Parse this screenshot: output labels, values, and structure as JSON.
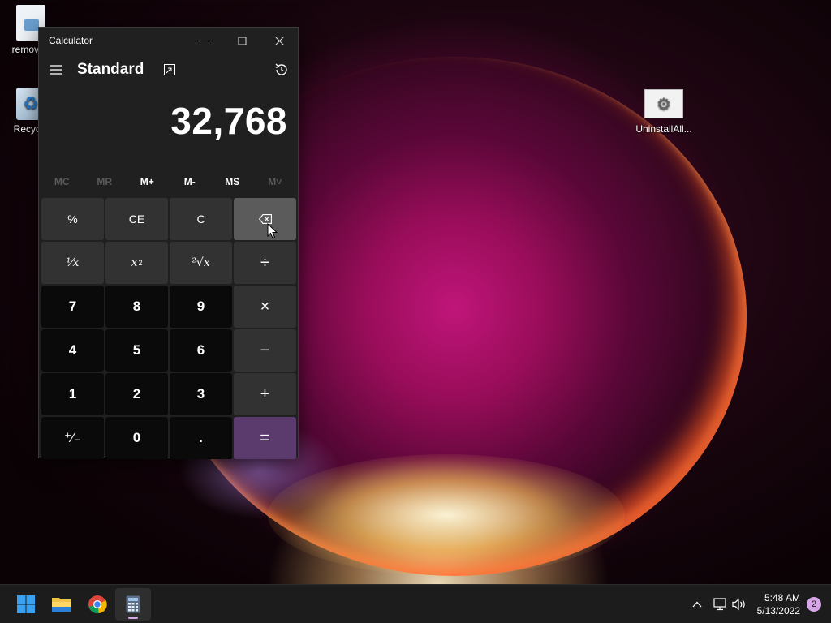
{
  "desktop": {
    "icons": [
      {
        "label": "remove_",
        "icon": "file-icon"
      },
      {
        "label": "Recycle",
        "icon": "recycle-bin-icon"
      },
      {
        "label": "UninstallAll...",
        "icon": "setup-icon"
      }
    ]
  },
  "calculator": {
    "window_title": "Calculator",
    "mode": "Standard",
    "display_value": "32,768",
    "memory_buttons": [
      {
        "label": "MC",
        "enabled": false
      },
      {
        "label": "MR",
        "enabled": false
      },
      {
        "label": "M+",
        "enabled": true
      },
      {
        "label": "M-",
        "enabled": true
      },
      {
        "label": "MS",
        "enabled": true
      },
      {
        "label": "M˅",
        "enabled": false
      }
    ],
    "keys": {
      "percent": "%",
      "ce": "CE",
      "c": "C",
      "reciprocal": "¹⁄x",
      "square_base": "x",
      "square_exp": "2",
      "sqrt": "²√x",
      "divide": "÷",
      "multiply": "×",
      "minus": "−",
      "plus": "+",
      "equals": "=",
      "negate": "⁺⁄₋",
      "decimal": ".",
      "d0": "0",
      "d1": "1",
      "d2": "2",
      "d3": "3",
      "d4": "4",
      "d5": "5",
      "d6": "6",
      "d7": "7",
      "d8": "8",
      "d9": "9"
    },
    "accent_color": "#5b3b6e"
  },
  "taskbar": {
    "apps": [
      "start-icon",
      "file-explorer-icon",
      "chrome-icon",
      "calculator-icon"
    ],
    "time": "5:48 AM",
    "date": "5/13/2022",
    "notification_count": "2"
  }
}
